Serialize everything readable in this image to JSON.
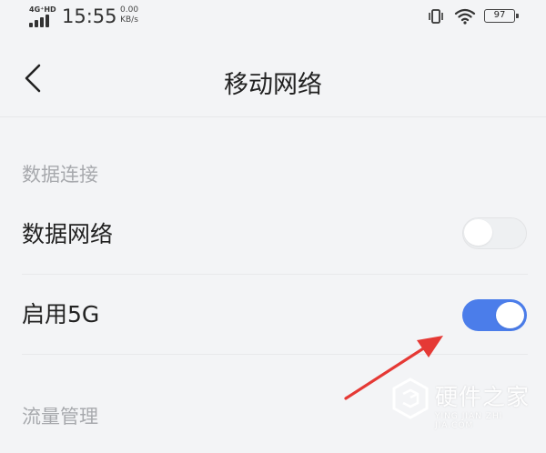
{
  "status_bar": {
    "network": "4G⁺HD",
    "time": "15:55",
    "speed_value": "0.00",
    "speed_unit": "KB/s",
    "battery": "97"
  },
  "header": {
    "title": "移动网络"
  },
  "sections": [
    {
      "header": "数据连接",
      "rows": [
        {
          "label": "数据网络",
          "toggle_on": false
        },
        {
          "label": "启用5G",
          "toggle_on": true
        }
      ]
    },
    {
      "header": "流量管理"
    }
  ],
  "watermark": {
    "name": "硬件之家",
    "subtitle": "YING JIAN ZHI JIA.COM"
  },
  "colors": {
    "accent": "#4b7dea",
    "arrow": "#e53935",
    "toggle_off": "#eef0f2",
    "section_header": "#a7a9ad"
  }
}
